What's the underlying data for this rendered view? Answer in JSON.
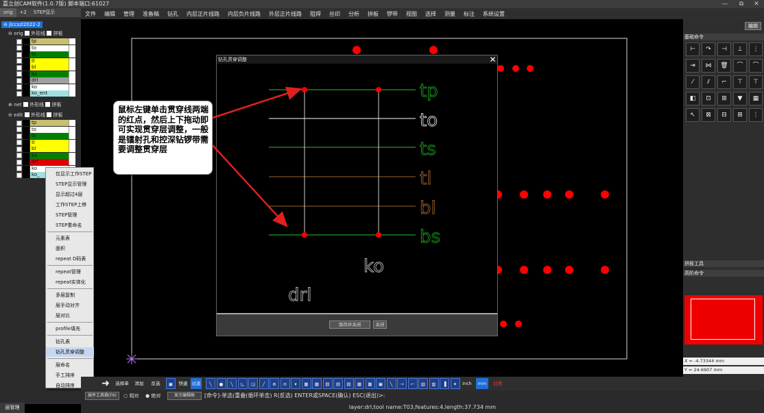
{
  "app": {
    "title": "嘉立创CAM软件(1.0.7版) 脚本端口:61027",
    "win_controls": [
      "—",
      "⧉",
      "✕"
    ]
  },
  "menu": [
    "文件",
    "编辑",
    "管理",
    "准备稿",
    "钻孔",
    "内层正片线路",
    "内层负片线路",
    "外层正片线路",
    "阻焊",
    "丝印",
    "分析",
    "拼板",
    "锣带",
    "视图",
    "选择",
    "测量",
    "标注",
    "系统设置"
  ],
  "left_panel": {
    "tabs": [
      "orig",
      "+2",
      "STEP显示"
    ],
    "job": "jlccszl2022-2",
    "orig_step": {
      "name": "orig",
      "opt1": "外形线",
      "opt2": "拼板"
    },
    "orig_layers": [
      {
        "name": "tp",
        "color": "#c8c070"
      },
      {
        "name": "to",
        "color": "#ffffff"
      },
      {
        "name": "ts",
        "color": "#008000"
      },
      {
        "name": "tl",
        "color": "#ffff00"
      },
      {
        "name": "bl",
        "color": "#ffff00"
      },
      {
        "name": "bs",
        "color": "#008000"
      },
      {
        "name": "drl",
        "color": "#a0a0a0"
      },
      {
        "name": "ko",
        "color": "#ffffff"
      },
      {
        "name": "ko_ent",
        "color": "#a0e0e0"
      }
    ],
    "net_step": {
      "name": "net",
      "opt1": "外形线",
      "opt2": "拼板"
    },
    "edit_step": {
      "name": "edit",
      "opt1": "外形线",
      "opt2": "拼板"
    },
    "edit_layers": [
      {
        "name": "tp",
        "color": "#c8c070"
      },
      {
        "name": "to",
        "color": "#ffffff"
      },
      {
        "name": "ts",
        "color": "#008000"
      },
      {
        "name": "tl",
        "color": "#ffff00"
      },
      {
        "name": "bl",
        "color": "#ffff00"
      },
      {
        "name": "bs",
        "color": "#008000"
      },
      {
        "name": "drl",
        "color": "#e00000"
      },
      {
        "name": "ko",
        "color": "#ffffff"
      },
      {
        "name": "ko_",
        "color": "#a0e0e0"
      }
    ],
    "bottom_tab": "层管理"
  },
  "context_menu": {
    "items": [
      "仅显示工作STEP",
      "STEP显示管理",
      "显示超过4层",
      "工作STEP上移",
      "STEP管理",
      "STEP重命名",
      "元素表",
      "面积",
      "repeat D码表",
      "repeat管理",
      "repeat实体化",
      "多层复制",
      "层手动对齐",
      "层对比",
      "profile填充",
      "钻孔表",
      "钻孔贯穿调整",
      "层命名",
      "手工排序",
      "自动排序"
    ],
    "highlight": "钻孔贯穿调整"
  },
  "right_panel": {
    "edit_button": "编辑",
    "sections": [
      "基础命令",
      "拼板工具",
      "高阶命令"
    ],
    "coords": [
      "X = -4.73344 mm",
      "Y = 24.6907 mm"
    ]
  },
  "dialog": {
    "title": "钻孔贯穿调整",
    "layer_labels": [
      "tp",
      "to",
      "ts",
      "tl",
      "bl",
      "bs"
    ],
    "drill_label": "drl",
    "ko_label": "ko",
    "save_button": "保存并关闭",
    "close_button": "关闭"
  },
  "callout": {
    "text": "鼠标左键单击贯穿线两端的红点，然后上下拖动即可实现贯穿层调整，一般是镭射孔和控深钻锣带需要调整贯穿层"
  },
  "toolbar": {
    "select_single": "选择单",
    "add": "添加",
    "invert": "反选",
    "quick": "快速",
    "filter": "过滤",
    "inch": "inch",
    "mm": "mm",
    "ratio": "比例(%)"
  },
  "cmdbar": {
    "tool_table": "插件工具箱(F6)",
    "relative": "相对",
    "absolute": "绝对",
    "display_editor": "显示编辑框",
    "prompt": "[命令]-单选(重叠(循环单击) R(反选) ENTER或SPACE(确认) ESC(退出)>:"
  },
  "status": "layer:drl,tool name:T03,features:4,length:37.734 mm",
  "colors": {
    "accent_blue": "#1e6fd9",
    "pad_red": "#ff0000"
  }
}
